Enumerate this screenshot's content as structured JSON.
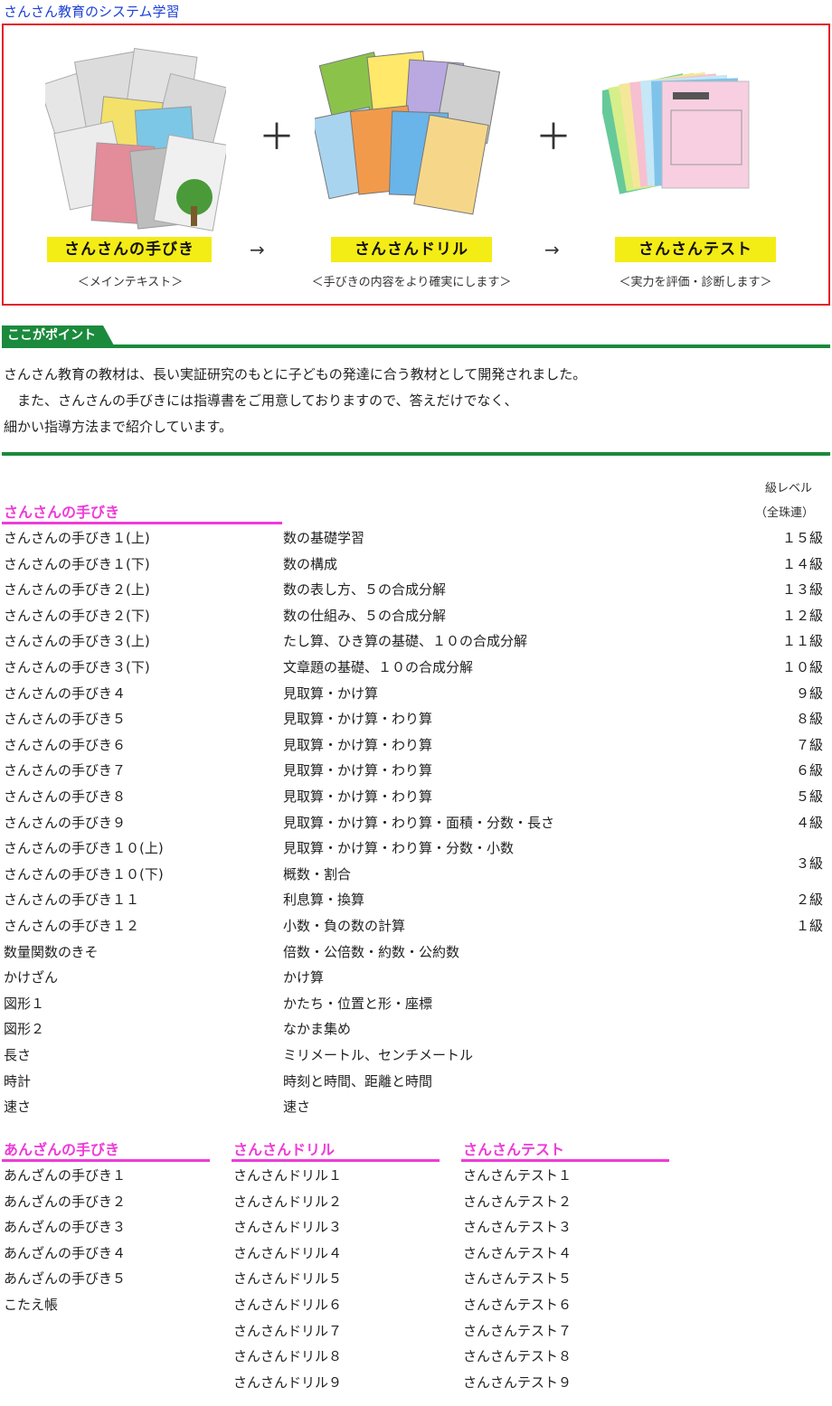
{
  "page_title": "さんさん教育のシステム学習",
  "system": {
    "items": [
      {
        "label": "さんさんの手びき",
        "sub": "＜メインテキスト＞"
      },
      {
        "label": "さんさんドリル",
        "sub": "＜手びきの内容をより確実にします＞"
      },
      {
        "label": "さんさんテスト",
        "sub": "＜実力を評価・診断します＞"
      }
    ],
    "plus": "＋",
    "arrow": "→",
    "colors": {
      "highlight": "#f4ec15",
      "border": "#e2202a"
    }
  },
  "point": {
    "tag": "ここがポイント",
    "lines": [
      "さんさん教育の教材は、長い実証研究のもとに子どもの発達に合う教材として開発されました。",
      "　また、さんさんの手びきには指導書をご用意しておりますので、答えだけでなく、",
      "細かい指導方法まで紹介しています。"
    ],
    "color": "#1b8a3c"
  },
  "level_header": {
    "line1": "級レベル",
    "line2": "（全珠連）"
  },
  "tebiki": {
    "title": "さんさんの手びき",
    "rows": [
      {
        "name": "さんさんの手びき１(上)",
        "topic": "数の基礎学習",
        "level": "１５級"
      },
      {
        "name": "さんさんの手びき１(下)",
        "topic": "数の構成",
        "level": "１４級"
      },
      {
        "name": "さんさんの手びき２(上)",
        "topic": "数の表し方、５の合成分解",
        "level": "１３級"
      },
      {
        "name": "さんさんの手びき２(下)",
        "topic": "数の仕組み、５の合成分解",
        "level": "１２級"
      },
      {
        "name": "さんさんの手びき３(上)",
        "topic": "たし算、ひき算の基礎、１０の合成分解",
        "level": "１１級"
      },
      {
        "name": "さんさんの手びき３(下)",
        "topic": "文章題の基礎、１０の合成分解",
        "level": "１０級"
      },
      {
        "name": "さんさんの手びき４",
        "topic": "見取算・かけ算",
        "level": "９級"
      },
      {
        "name": "さんさんの手びき５",
        "topic": "見取算・かけ算・わり算",
        "level": "８級"
      },
      {
        "name": "さんさんの手びき６",
        "topic": "見取算・かけ算・わり算",
        "level": "７級"
      },
      {
        "name": "さんさんの手びき７",
        "topic": "見取算・かけ算・わり算",
        "level": "６級"
      },
      {
        "name": "さんさんの手びき８",
        "topic": "見取算・かけ算・わり算",
        "level": "５級"
      },
      {
        "name": "さんさんの手びき９",
        "topic": "見取算・かけ算・わり算・面積・分数・長さ",
        "level": "４級"
      },
      {
        "name": "さんさんの手びき１０(上)",
        "topic": "見取算・かけ算・わり算・分数・小数",
        "level": ""
      },
      {
        "name": "さんさんの手びき１０(下)",
        "topic": "概数・割合",
        "level": ""
      },
      {
        "name": "さんさんの手びき１１",
        "topic": "利息算・換算",
        "level": "２級"
      },
      {
        "name": "さんさんの手びき１２",
        "topic": "小数・負の数の計算",
        "level": "１級"
      },
      {
        "name": "数量関数のきそ",
        "topic": "倍数・公倍数・約数・公約数",
        "level": ""
      },
      {
        "name": "かけざん",
        "topic": "かけ算",
        "level": ""
      },
      {
        "name": "図形１",
        "topic": "かたち・位置と形・座標",
        "level": ""
      },
      {
        "name": "図形２",
        "topic": "なかま集め",
        "level": ""
      },
      {
        "name": "長さ",
        "topic": "ミリメートル、センチメートル",
        "level": ""
      },
      {
        "name": "時計",
        "topic": "時刻と時間、距離と時間",
        "level": ""
      },
      {
        "name": "速さ",
        "topic": "速さ",
        "level": ""
      }
    ],
    "merged_level": "３級"
  },
  "anzan": {
    "title": "あんざんの手びき",
    "items": [
      "あんざんの手びき１",
      "あんざんの手びき２",
      "あんざんの手びき３",
      "あんざんの手びき４",
      "あんざんの手びき５",
      "こたえ帳"
    ]
  },
  "drill": {
    "title": "さんさんドリル",
    "items": [
      "さんさんドリル１",
      "さんさんドリル２",
      "さんさんドリル３",
      "さんさんドリル４",
      "さんさんドリル５",
      "さんさんドリル６",
      "さんさんドリル７",
      "さんさんドリル８",
      "さんさんドリル９"
    ]
  },
  "test": {
    "title": "さんさんテスト",
    "items": [
      "さんさんテスト１",
      "さんさんテスト２",
      "さんさんテスト３",
      "さんさんテスト４",
      "さんさんテスト５",
      "さんさんテスト６",
      "さんさんテスト７",
      "さんさんテスト８",
      "さんさんテスト９"
    ]
  },
  "accent_color": "#ee3bd8"
}
